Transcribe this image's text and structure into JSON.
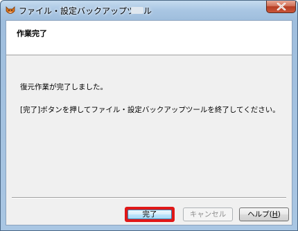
{
  "window": {
    "title": "ファイル・設定バックアップツール",
    "accent_color": "#e01818"
  },
  "page": {
    "title": "作業完了",
    "message_1": "復元作業が完了しました。",
    "message_2": "[完了]ボタンを押してファイル・設定バックアップツールを終了してください。"
  },
  "buttons": {
    "finish": "完了",
    "cancel": "キャンセル",
    "help_text": "ヘルプ(",
    "help_mnemonic": "H",
    "help_close": ")"
  },
  "icons": {
    "app": "fox-app-icon",
    "close": "close-icon"
  }
}
